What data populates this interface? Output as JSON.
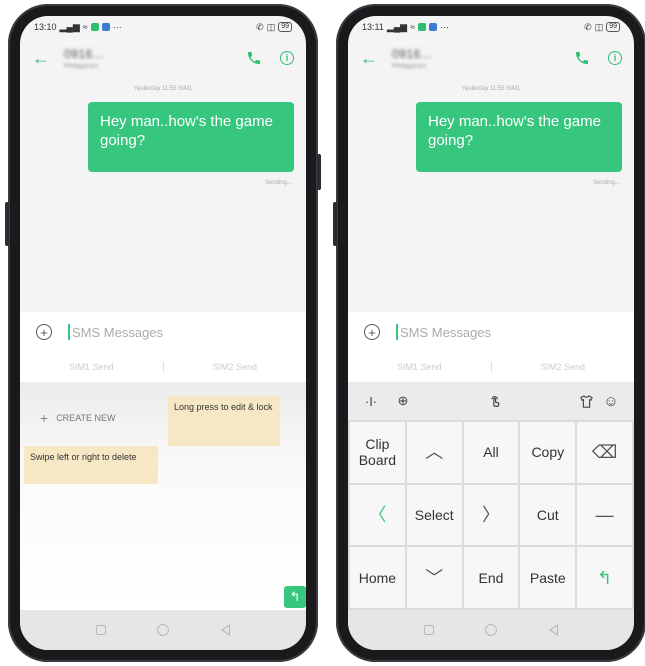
{
  "left_phone": {
    "status_time": "13:10",
    "status_battery": "99",
    "contact_number": "0916...",
    "contact_sub": "Philippines",
    "timestamp": "Yesterday 11:55 SIM1",
    "message": "Hey man..how's the game going?",
    "message_status": "Sending...",
    "compose_placeholder": "SMS Messages",
    "sim1_send": "SIM1 Send",
    "sim2_send": "SIM2 Send",
    "clipboard": {
      "create_new": "CREATE NEW",
      "note_hint_edit": "Long press to edit & lock",
      "note_hint_delete": "Swipe left or right to delete"
    }
  },
  "right_phone": {
    "status_time": "13:11",
    "status_battery": "99",
    "contact_number": "0916...",
    "contact_sub": "Philippines",
    "timestamp": "Yesterday 11:55 SIM1",
    "message": "Hey man..how's the game going?",
    "message_status": "Sending...",
    "compose_placeholder": "SMS Messages",
    "sim1_send": "SIM1 Send",
    "sim2_send": "SIM2 Send",
    "keyboard": {
      "toolbar": {
        "cursor_icon": "·I·",
        "globe_icon": "⊕",
        "tap_icon": "tap",
        "shirt_icon": "shirt",
        "emoji_icon": "☺"
      },
      "keys": {
        "clipboard": "Clip Board",
        "up": "︿",
        "all": "All",
        "copy": "Copy",
        "backspace": "⌫",
        "left": "〈",
        "select": "Select",
        "right": "〉",
        "cut": "Cut",
        "space": "—",
        "home": "Home",
        "down": "﹀",
        "end": "End",
        "paste": "Paste",
        "enter": "↰"
      }
    }
  },
  "colors": {
    "accent": "#37c67e",
    "note": "#f6e8c5",
    "phone_frame": "#1a1a1c"
  }
}
